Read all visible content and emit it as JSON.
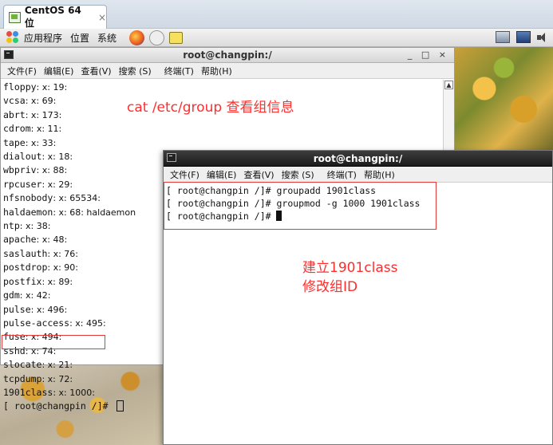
{
  "vm_tab": {
    "label": "CentOS 64 位",
    "close": "×"
  },
  "panel": {
    "menus": [
      "应用程序",
      "位置",
      "系统"
    ]
  },
  "term1": {
    "title": "root@changpin:/",
    "controls": "_ □ ×",
    "menu": [
      "文件(F)",
      "编辑(E)",
      "查看(V)",
      "搜索 (S)",
      "终端(T)",
      "帮助(H)"
    ],
    "lines": [
      {
        "name": "floppy",
        "rest": ": x: 19:"
      },
      {
        "name": "vcsa",
        "rest": ": x: 69:"
      },
      {
        "name": "abrt",
        "rest": ": x: 173:"
      },
      {
        "name": "cdrom",
        "rest": ": x: 11:"
      },
      {
        "name": "tape",
        "rest": ": x: 33:"
      },
      {
        "name": "dialout",
        "rest": ": x: 18:"
      },
      {
        "name": "wbpriv",
        "rest": ": x: 88:"
      },
      {
        "name": "rpcuser",
        "rest": ": x: 29:"
      },
      {
        "name": "nfsnobody",
        "rest": ": x: 65534:"
      },
      {
        "name": "haldaemon",
        "rest": ": x: 68: haldaemon"
      },
      {
        "name": "ntp",
        "rest": ": x: 38:"
      },
      {
        "name": "apache",
        "rest": ": x: 48:"
      },
      {
        "name": "saslauth",
        "rest": ": x: 76:"
      },
      {
        "name": "postdrop",
        "rest": ": x: 90:"
      },
      {
        "name": "postfix",
        "rest": ": x: 89:"
      },
      {
        "name": "gdm",
        "rest": ": x: 42:"
      },
      {
        "name": "pulse",
        "rest": ": x: 496:"
      },
      {
        "name": "pulse-access",
        "rest": ": x: 495:"
      },
      {
        "name": "fuse",
        "rest": ": x: 494:"
      },
      {
        "name": "sshd",
        "rest": ": x: 74:"
      },
      {
        "name": "slocate",
        "rest": ": x: 21:"
      },
      {
        "name": "tcpdump",
        "rest": ": x: 72:"
      },
      {
        "name": "1901class",
        "rest": ": x: 1000:"
      }
    ],
    "prompt": "[ root@changpin /]# "
  },
  "annotation_group_info": "cat /etc/group 查看组信息",
  "term2": {
    "title": "root@changpin:/",
    "menu": [
      "文件(F)",
      "编辑(E)",
      "查看(V)",
      "搜索 (S)",
      "终端(T)",
      "帮助(H)"
    ],
    "lines": [
      "[ root@changpin /]# groupadd 1901class",
      "[ root@changpin /]# groupmod -g 1000 1901class",
      "[ root@changpin /]# "
    ]
  },
  "annotation_create": [
    "建立1901class",
    "修改组ID"
  ],
  "colors": {
    "annotation": "#ff2d2d",
    "highlight_box": "#e23a3a"
  }
}
